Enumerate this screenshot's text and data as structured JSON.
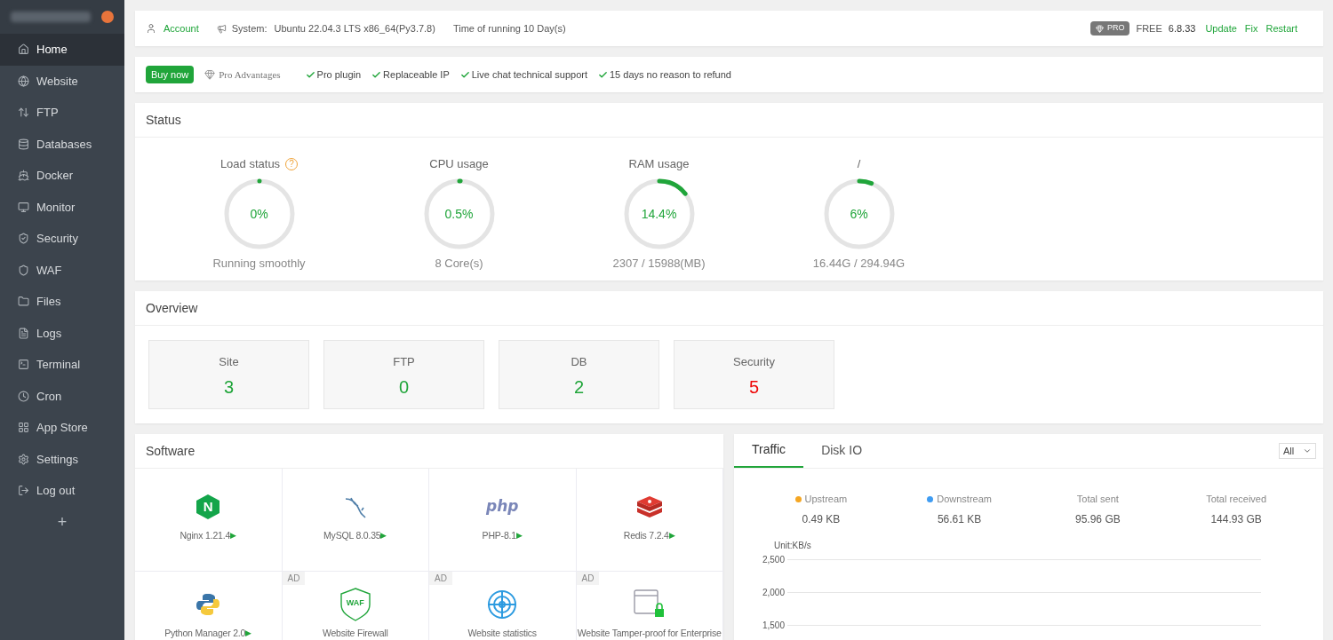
{
  "sidebar": {
    "items": [
      {
        "label": "Home",
        "selected": true
      },
      {
        "label": "Website",
        "selected": false
      },
      {
        "label": "FTP",
        "selected": false
      },
      {
        "label": "Databases",
        "selected": false
      },
      {
        "label": "Docker",
        "selected": false
      },
      {
        "label": "Monitor",
        "selected": false
      },
      {
        "label": "Security",
        "selected": false
      },
      {
        "label": "WAF",
        "selected": false
      },
      {
        "label": "Files",
        "selected": false
      },
      {
        "label": "Logs",
        "selected": false
      },
      {
        "label": "Terminal",
        "selected": false
      },
      {
        "label": "Cron",
        "selected": false
      },
      {
        "label": "App Store",
        "selected": false
      },
      {
        "label": "Settings",
        "selected": false
      },
      {
        "label": "Log out",
        "selected": false
      }
    ],
    "add": "+"
  },
  "header": {
    "account": "Account",
    "system_label": "System:",
    "system": "Ubuntu 22.04.3 LTS x86_64(Py3.7.8)",
    "uptime": "Time of running 10 Day(s)",
    "pro_badge": "PRO",
    "edition": "FREE",
    "version": "6.8.33",
    "actions": [
      "Update",
      "Fix",
      "Restart"
    ]
  },
  "promo": {
    "button": "Buy now",
    "advantages": "Pro Advantages",
    "features": [
      "Pro plugin",
      "Replaceable IP",
      "Live chat technical support",
      "15 days no reason to refund"
    ]
  },
  "status": {
    "title": "Status",
    "gauges": [
      {
        "label": "Load status",
        "help": "?",
        "value": "0%",
        "level": 0,
        "caption": "Running smoothly"
      },
      {
        "label": "CPU usage",
        "value": "0.5%",
        "level": 0.005,
        "caption": "8 Core(s)"
      },
      {
        "label": "RAM usage",
        "value": "14.4%",
        "level": 0.144,
        "caption": "2307 / 15988(MB)"
      },
      {
        "label": "/",
        "value": "6%",
        "level": 0.06,
        "caption": "16.44G / 294.94G"
      }
    ]
  },
  "overview": {
    "title": "Overview",
    "cards": [
      {
        "label": "Site",
        "value": "3",
        "warning": false
      },
      {
        "label": "FTP",
        "value": "0",
        "warning": false
      },
      {
        "label": "DB",
        "value": "2",
        "warning": false
      },
      {
        "label": "Security",
        "value": "5",
        "warning": true
      }
    ]
  },
  "software": {
    "title": "Software",
    "items": [
      {
        "kind": "app",
        "logo_text": "N",
        "name": "Nginx 1.21.4",
        "arrow": "▶"
      },
      {
        "kind": "app",
        "name": "MySQL 8.0.35",
        "arrow": "▶"
      },
      {
        "kind": "app",
        "logo_text": "php",
        "name": "PHP-8.1",
        "arrow": "▶"
      },
      {
        "kind": "app",
        "name": "Redis 7.2.4",
        "arrow": "▶"
      },
      {
        "kind": "app",
        "name": "Python Manager 2.0",
        "arrow": "▶"
      },
      {
        "kind": "ad",
        "badge": "AD",
        "logo_text": "WAF",
        "name": "Website Firewall"
      },
      {
        "kind": "ad",
        "badge": "AD",
        "name": "Website statistics"
      },
      {
        "kind": "ad",
        "badge": "AD",
        "name": "Website Tamper-proof for Enterprise"
      }
    ]
  },
  "traffic": {
    "tabs": [
      {
        "label": "Traffic",
        "selected": true
      },
      {
        "label": "Disk IO",
        "selected": false
      }
    ],
    "filter": "All",
    "stats": [
      {
        "label": "Upstream",
        "value": "0.49 KB",
        "color": "#f5a623"
      },
      {
        "label": "Downstream",
        "value": "56.61 KB",
        "color": "#3f9cf2"
      },
      {
        "label": "Total sent",
        "value": "95.96 GB"
      },
      {
        "label": "Total received",
        "value": "144.93 GB"
      }
    ],
    "axis_unit": "Unit:KB/s",
    "axis_ticks": [
      "2,500",
      "2,000",
      "1,500"
    ]
  }
}
